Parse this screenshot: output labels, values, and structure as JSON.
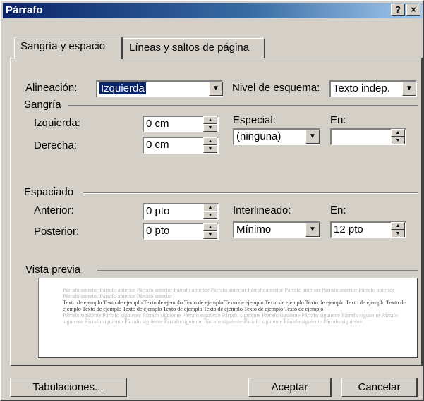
{
  "window": {
    "title": "Párrafo",
    "help_label": "?",
    "close_label": "×"
  },
  "tabs": [
    {
      "label": "Sangría y espacio"
    },
    {
      "label": "Líneas y saltos de página"
    }
  ],
  "alignment": {
    "label": "Alineación:",
    "value": "Izquierda"
  },
  "outline": {
    "label": "Nivel de esquema:",
    "value": "Texto indep."
  },
  "indent": {
    "group_label": "Sangría",
    "left_label": "Izquierda:",
    "left_value": "0 cm",
    "right_label": "Derecha:",
    "right_value": "0 cm",
    "special_label": "Especial:",
    "special_value": "(ninguna)",
    "by_label": "En:",
    "by_value": ""
  },
  "spacing": {
    "group_label": "Espaciado",
    "before_label": "Anterior:",
    "before_value": "0 pto",
    "after_label": "Posterior:",
    "after_value": "0 pto",
    "line_label": "Interlineado:",
    "line_value": "Mínimo",
    "at_label": "En:",
    "at_value": "12 pto"
  },
  "preview": {
    "group_label": "Vista previa",
    "prev_text": "Párrafo anterior Párrafo anterior Párrafo anterior Párrafo anterior Párrafo anterior Párrafo anterior Párrafo anterior Párrafo anterior Párrafo anterior Párrafo anterior Párrafo anterior Párrafo anterior",
    "sample_text": "Texto de ejemplo Texto de ejemplo Texto de ejemplo Texto de ejemplo Texto de ejemplo Texto de ejemplo Texto de ejemplo Texto de ejemplo Texto de ejemplo Texto de ejemplo Texto de ejemplo Texto de ejemplo Texto de ejemplo Texto de ejemplo Texto de ejemplo",
    "next_text": "Párrafo siguiente Párrafo siguiente Párrafo siguiente Párrafo siguiente Párrafo siguiente Párrafo siguiente Párrafo siguiente Párrafo siguiente Párrafo siguiente Párrafo siguiente Párrafo siguiente Párrafo siguiente Párrafo siguiente Párrafo siguiente Párrafo siguiente Párrafo siguiente"
  },
  "buttons": {
    "tabs": "Tabulaciones...",
    "ok": "Aceptar",
    "cancel": "Cancelar"
  }
}
